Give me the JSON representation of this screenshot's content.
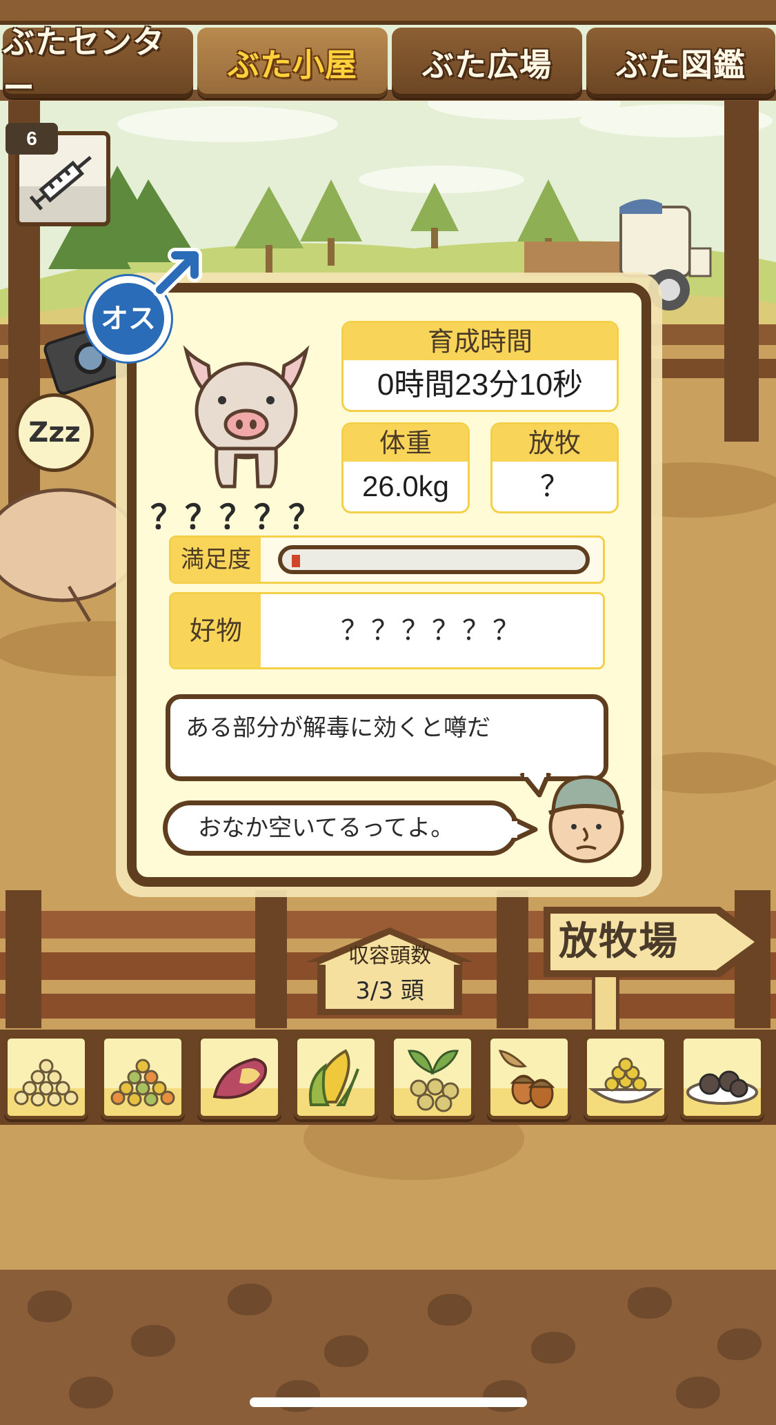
{
  "tabs": [
    {
      "label": "ぶたセンター",
      "active": false
    },
    {
      "label": "ぶた小屋",
      "active": true
    },
    {
      "label": "ぶた広場",
      "active": false
    },
    {
      "label": "ぶた図鑑",
      "active": false
    }
  ],
  "medicine": {
    "count": "6",
    "icon": "syringe-icon"
  },
  "sleep_bubble": "Zzz",
  "pig_card": {
    "gender_label": "オス",
    "gender_icon": "male-symbol-icon",
    "name": "？？？？？",
    "growth_time": {
      "label": "育成時間",
      "value": "0時間23分10秒"
    },
    "weight": {
      "label": "体重",
      "value": "26.0kg"
    },
    "grazing": {
      "label": "放牧",
      "value": "？"
    },
    "satisfaction": {
      "label": "満足度",
      "level": 0.03,
      "fill_color": "#d0462a"
    },
    "favorite": {
      "label": "好物",
      "value": "？？？？？？"
    },
    "trivia": "ある部分が解毒に効くと噂だ",
    "farmer_comment": "おなか空いてるってよ。"
  },
  "capacity": {
    "label": "収容頭数",
    "value": "3/3 頭"
  },
  "pasture_sign": "放牧場",
  "foods": [
    {
      "name": "soybeans-icon"
    },
    {
      "name": "mixed-grains-icon"
    },
    {
      "name": "sweet-potato-icon"
    },
    {
      "name": "corn-icon"
    },
    {
      "name": "herb-nuts-icon"
    },
    {
      "name": "acorns-icon"
    },
    {
      "name": "bean-dish-icon"
    },
    {
      "name": "truffle-plate-icon"
    }
  ]
}
